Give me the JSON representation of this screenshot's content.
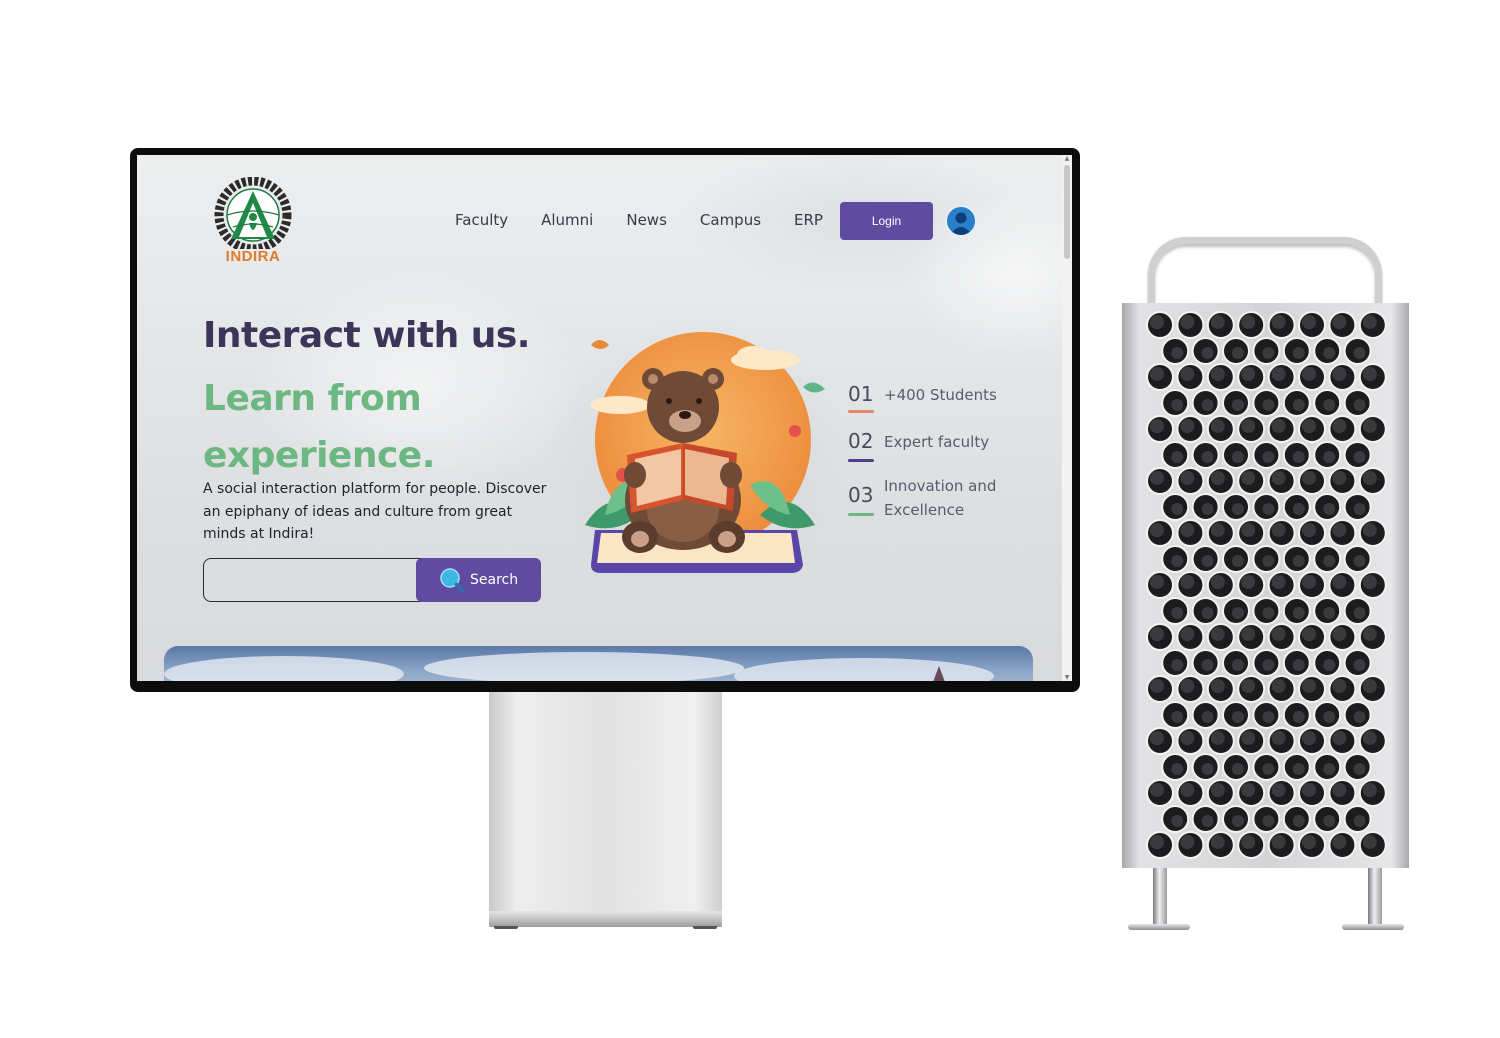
{
  "brand": {
    "logo_text": "INDIRA",
    "accent": "#5f4ba0",
    "green": "#6db882",
    "orange": "#e07b2a"
  },
  "nav": {
    "items": [
      {
        "label": "Faculty"
      },
      {
        "label": "Alumni"
      },
      {
        "label": "News"
      },
      {
        "label": "Campus"
      },
      {
        "label": "ERP"
      }
    ],
    "login_label": "Login",
    "avatar_icon": "user-avatar-icon"
  },
  "hero": {
    "title": "Interact with us.",
    "subtitle": "Learn from experience.",
    "description": "A social interaction platform for people. Discover an epiphany of ideas and culture from great minds at Indira!",
    "search": {
      "placeholder": "",
      "value": "",
      "button_label": "Search",
      "icon": "search-icon"
    }
  },
  "stats": [
    {
      "number": "01",
      "label": "+400 Students",
      "bar_color": "#e0896a"
    },
    {
      "number": "02",
      "label": "Expert faculty",
      "bar_color": "#4b3f8a"
    },
    {
      "number": "03",
      "label": "Innovation and Excellence",
      "bar_color": "#6db882"
    }
  ]
}
